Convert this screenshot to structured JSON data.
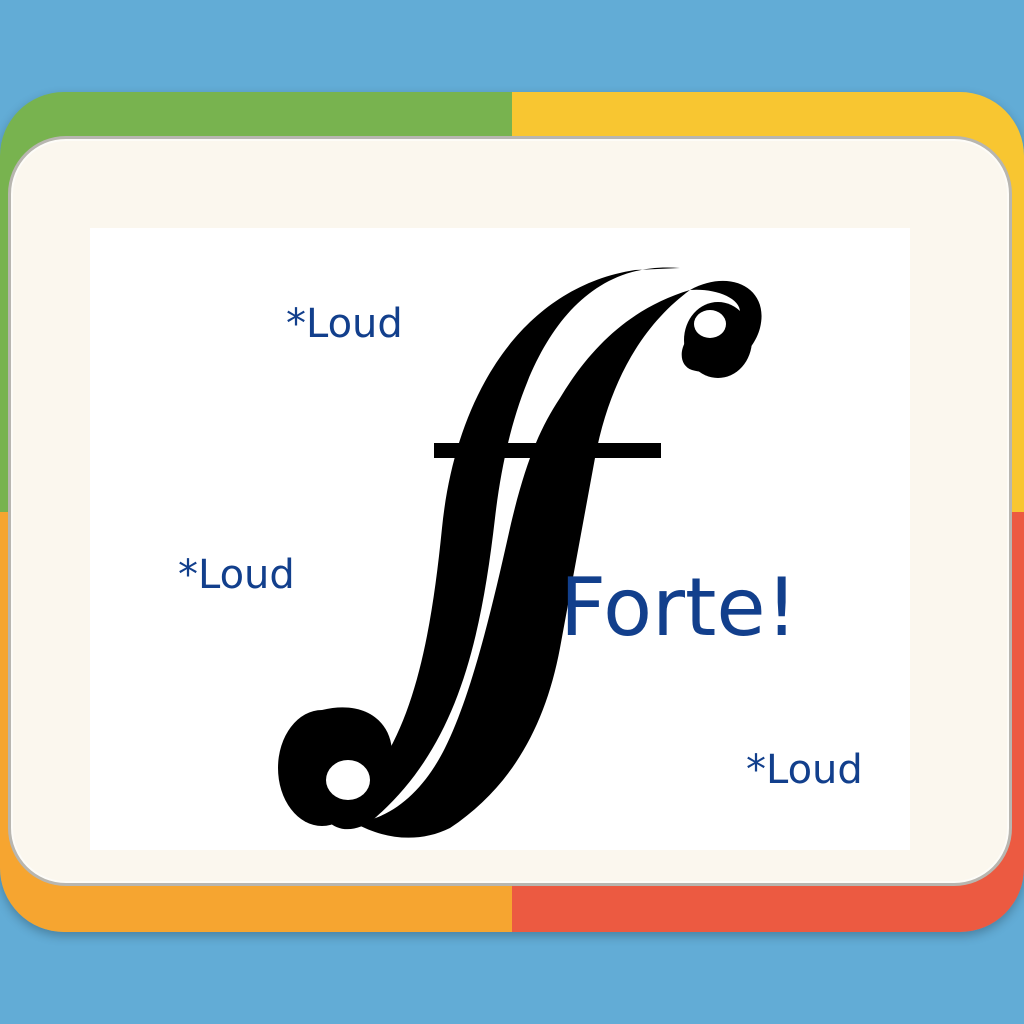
{
  "colors": {
    "background": "#62acd6",
    "quadrant_top_left": "#78b34f",
    "quadrant_top_right": "#f8c631",
    "quadrant_bottom_left": "#f6a530",
    "quadrant_bottom_right": "#ec5a41",
    "text": "#123f8c",
    "symbol": "#000000"
  },
  "card": {
    "symbol_name": "forte-f-icon",
    "labels": [
      "*Loud",
      "*Loud",
      "*Loud"
    ],
    "headline": "Forte!"
  }
}
